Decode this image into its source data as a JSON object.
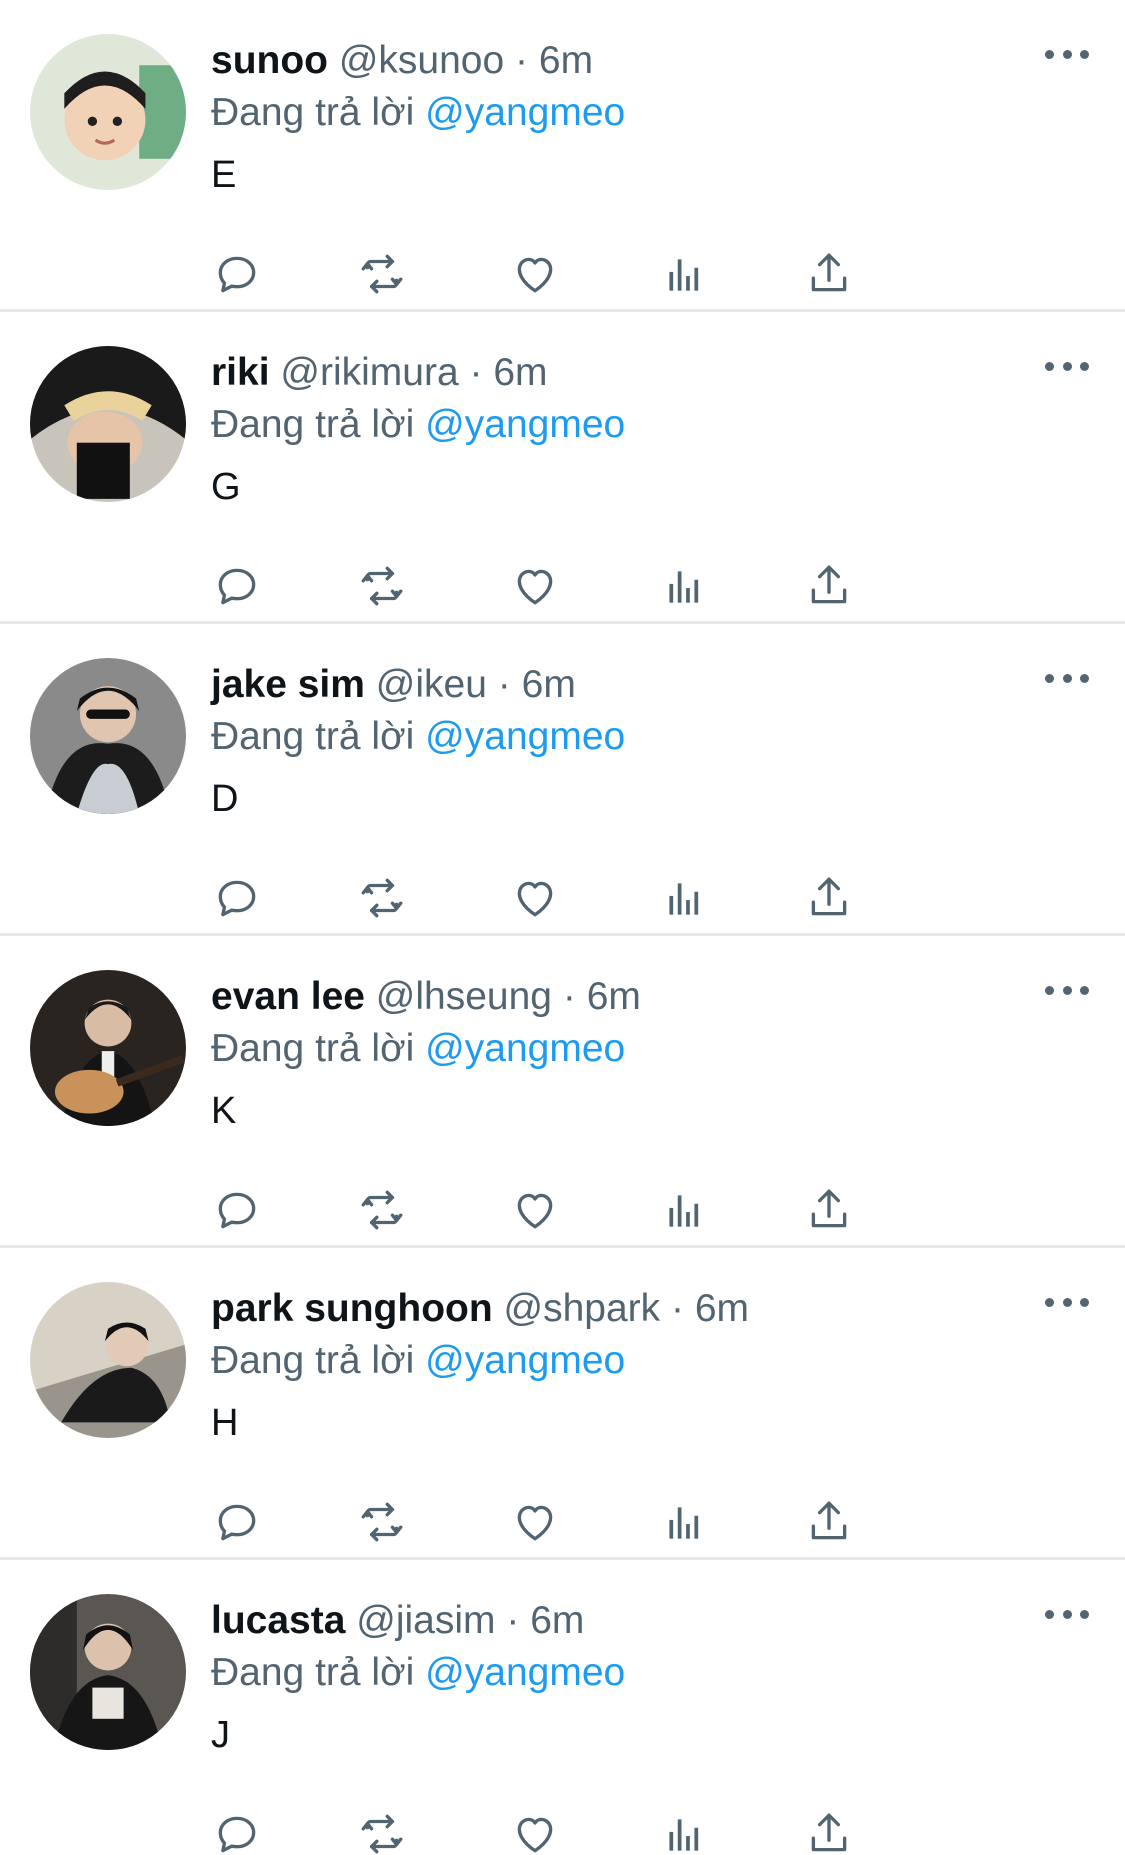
{
  "tweets": [
    {
      "name": "sunoo",
      "handle": "@ksunoo",
      "dot": "·",
      "time": "6m",
      "reply_prefix": "Đang trả lời",
      "reply_to": "@yangmeo",
      "text": "E"
    },
    {
      "name": "riki",
      "handle": "@rikimura",
      "dot": "·",
      "time": "6m",
      "reply_prefix": "Đang trả lời",
      "reply_to": "@yangmeo",
      "text": "G"
    },
    {
      "name": "jake sim",
      "handle": "@ikeu",
      "dot": "·",
      "time": "6m",
      "reply_prefix": "Đang trả lời",
      "reply_to": "@yangmeo",
      "text": "D"
    },
    {
      "name": "evan lee",
      "handle": "@lhseung",
      "dot": "·",
      "time": "6m",
      "reply_prefix": "Đang trả lời",
      "reply_to": "@yangmeo",
      "text": "K"
    },
    {
      "name": "park sunghoon",
      "handle": "@shpark",
      "dot": "·",
      "time": "6m",
      "reply_prefix": "Đang trả lời",
      "reply_to": "@yangmeo",
      "text": "H"
    },
    {
      "name": "lucasta",
      "handle": "@jiasim",
      "dot": "·",
      "time": "6m",
      "reply_prefix": "Đang trả lời",
      "reply_to": "@yangmeo",
      "text": "J"
    }
  ],
  "action_icons": [
    "reply-icon",
    "retweet-icon",
    "like-icon",
    "views-icon",
    "share-icon"
  ],
  "colors": {
    "text": "#0f1419",
    "secondary": "#536471",
    "link": "#1d9bf0",
    "divider": "#e6e9ec",
    "icon": "#536471"
  }
}
